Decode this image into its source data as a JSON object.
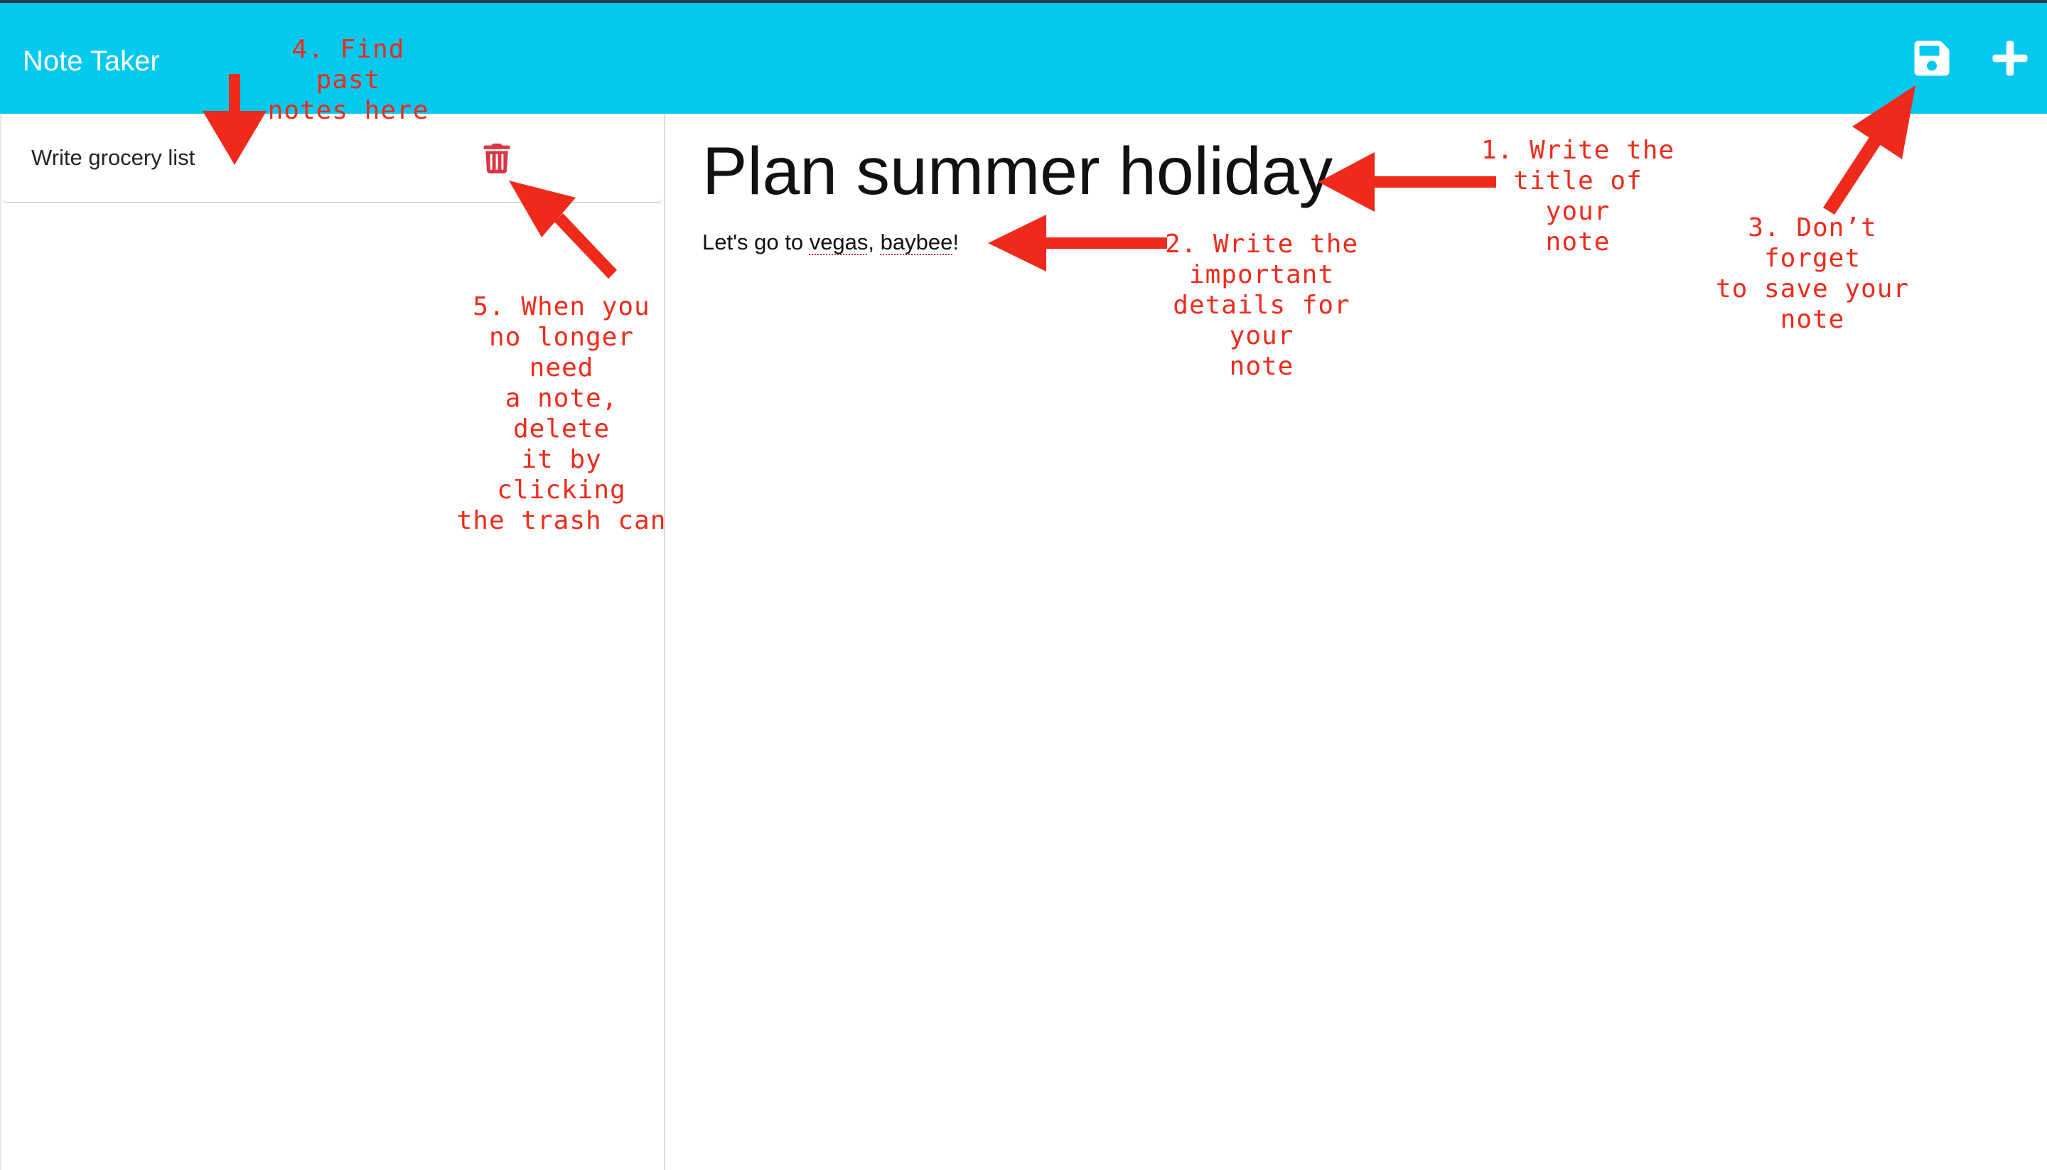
{
  "app": {
    "title": "Note Taker"
  },
  "toolbar": {
    "save_icon": "floppy-disk-icon",
    "new_icon": "plus-icon"
  },
  "sidebar": {
    "notes": [
      {
        "title": "Write grocery list",
        "delete_icon": "trash-icon"
      }
    ]
  },
  "editor": {
    "title": "Plan summer holiday",
    "body_parts": [
      "Let's go to ",
      "vegas",
      ", ",
      "baybee",
      "!"
    ]
  },
  "annotations": {
    "a1": "1. Write the\ntitle of your\nnote",
    "a2": "2. Write the\nimportant\ndetails for your\nnote",
    "a3": "3. Don’t forget\nto save your\nnote",
    "a4": "4. Find past\nnotes here",
    "a5": "5. When you\nno longer need\na note, delete\nit by clicking\nthe trash can"
  },
  "colors": {
    "navbar": "#03c9ef",
    "annotation": "#f02a1b",
    "trash": "#dc3545"
  }
}
